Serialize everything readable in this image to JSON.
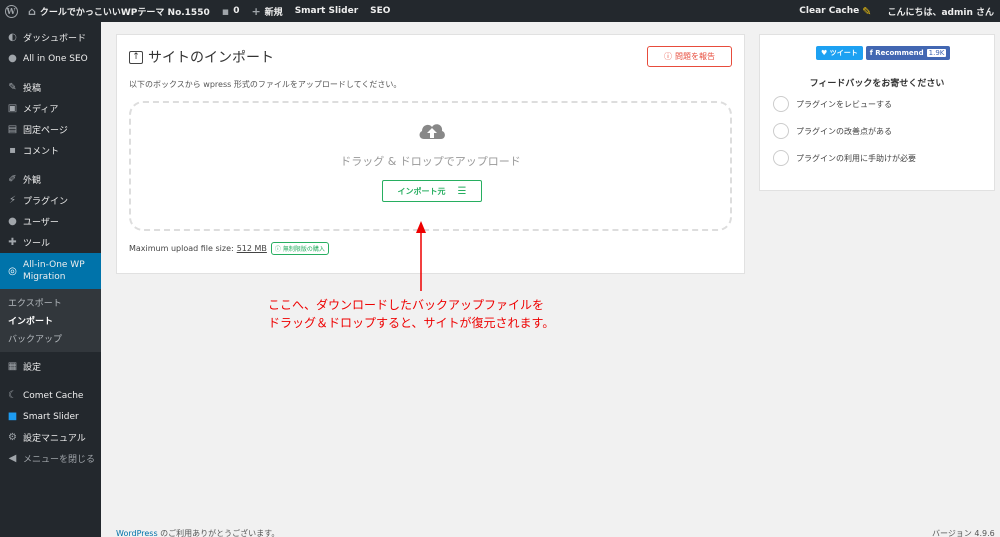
{
  "adminbar": {
    "site_name": "クールでかっこいいWPテーマ No.1550",
    "comments_count": "0",
    "new_label": "新規",
    "smart_slider": "Smart Slider",
    "seo": "SEO",
    "clear_cache": "Clear Cache",
    "greeting": "こんにちは、admin さん"
  },
  "sidebar": {
    "items": [
      {
        "icon": "dashboard-icon",
        "label": "ダッシュボード"
      },
      {
        "icon": "aioseo-icon",
        "label": "All in One SEO"
      },
      {
        "icon": "pin-icon",
        "label": "投稿"
      },
      {
        "icon": "media-icon",
        "label": "メディア"
      },
      {
        "icon": "page-icon",
        "label": "固定ページ"
      },
      {
        "icon": "comment-icon",
        "label": "コメント"
      },
      {
        "icon": "appearance-icon",
        "label": "外観"
      },
      {
        "icon": "plugin-icon",
        "label": "プラグイン"
      },
      {
        "icon": "user-icon",
        "label": "ユーザー"
      },
      {
        "icon": "tools-icon",
        "label": "ツール"
      }
    ],
    "current": {
      "line1": "All-in-One WP",
      "line2": "Migration"
    },
    "submenu": [
      "エクスポート",
      "インポート",
      "バックアップ"
    ],
    "after": [
      {
        "icon": "settings-icon",
        "label": "設定"
      },
      {
        "icon": "comet-cache-icon",
        "label": "Comet Cache"
      },
      {
        "icon": "smart-slider-icon",
        "label": "Smart Slider"
      },
      {
        "icon": "settings-manual-icon",
        "label": "設定マニュアル"
      }
    ],
    "collapse": "メニューを閉じる"
  },
  "import": {
    "title": "サイトのインポート",
    "report_button": "問題を報告",
    "description": "以下のボックスから wpress 形式のファイルをアップロードしてください。",
    "drop_text": "ドラッグ & ドロップでアップロード",
    "import_button": "インポート元",
    "max_size_label": "Maximum upload file size:",
    "max_size_value": "512 MB",
    "unlimited_badge": "無制限版の購入"
  },
  "annotation": {
    "line1": "ここへ、ダウンロードしたバックアップファイルを",
    "line2": "ドラッグ＆ドロップすると、サイトが復元されます。"
  },
  "feedback": {
    "tweet": "ツイート",
    "recommend": "Recommend",
    "recommend_count": "1.9K",
    "title": "フィードバックをお寄せください",
    "options": [
      "プラグインをレビューする",
      "プラグインの改善点がある",
      "プラグインの利用に手助けが必要"
    ]
  },
  "footer": {
    "link": "WordPress",
    "thanks": " のご利用ありがとうございます。",
    "version": "バージョン 4.9.6"
  },
  "colors": {
    "sidebar_bg": "#23282d",
    "accent": "#0073aa",
    "green": "#27ae60",
    "red": "#e74c3c",
    "annotation": "#e00000"
  }
}
